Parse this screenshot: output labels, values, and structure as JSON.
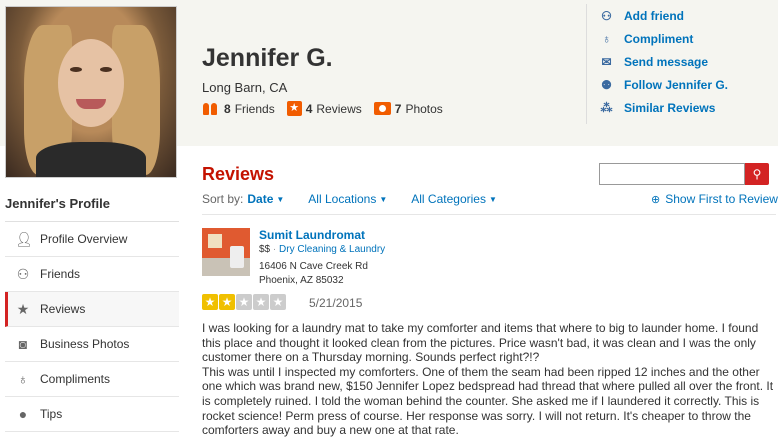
{
  "profile": {
    "name": "Jennifer G.",
    "location": "Long Barn, CA",
    "stats": {
      "friends_count": "8",
      "friends_label": "Friends",
      "reviews_count": "4",
      "reviews_label": "Reviews",
      "photos_count": "7",
      "photos_label": "Photos"
    }
  },
  "actions": [
    {
      "label": "Add friend",
      "icon": "add-friend-icon"
    },
    {
      "label": "Compliment",
      "icon": "compliment-icon"
    },
    {
      "label": "Send message",
      "icon": "envelope-icon"
    },
    {
      "label": "Follow Jennifer G.",
      "icon": "follow-icon"
    },
    {
      "label": "Similar Reviews",
      "icon": "similar-reviews-icon"
    }
  ],
  "sidebar": {
    "title": "Jennifer's Profile",
    "items": [
      {
        "label": "Profile Overview",
        "icon": "person-icon"
      },
      {
        "label": "Friends",
        "icon": "friends-icon"
      },
      {
        "label": "Reviews",
        "icon": "star-icon",
        "active": true
      },
      {
        "label": "Business Photos",
        "icon": "camera-icon"
      },
      {
        "label": "Compliments",
        "icon": "ribbon-icon"
      },
      {
        "label": "Tips",
        "icon": "lightbulb-icon"
      }
    ]
  },
  "reviews": {
    "title": "Reviews",
    "sort_label": "Sort by:",
    "sort_value": "Date",
    "locations_label": "All Locations",
    "categories_label": "All Categories",
    "search_placeholder": "",
    "show_first_label": "Show First to Review"
  },
  "review": {
    "business_name": "Sumit Laundromat",
    "price": "$$",
    "category": "Dry Cleaning & Laundry",
    "address_line1": "16406 N Cave Creek Rd",
    "address_line2": "Phoenix, AZ 85032",
    "rating": 2,
    "rating_max": 5,
    "date": "5/21/2015",
    "paragraph1": "I was looking for a laundry mat to take my comforter and items that where to big to launder home. I found this place and thought it looked clean from the pictures. Price wasn't bad, it was clean and I was the only customer there on a Thursday morning. Sounds perfect right?!?",
    "paragraph2": "This was until I inspected my comforters. One of them the seam had been ripped 12 inches and the other one which was brand new, $150 Jennifer Lopez bedspread had thread that where pulled all over the front. It is completely ruined. I told the woman behind the counter. She asked me if I laundered it correctly. This is rocket science! Perm press of course. Her response was sorry. I will not return. It's cheaper to throw the comforters away and buy a new one at that rate."
  },
  "colors": {
    "accent_red": "#d32323",
    "link_blue": "#0073bb",
    "orange": "#f15c00",
    "star_gold": "#f0c000"
  }
}
